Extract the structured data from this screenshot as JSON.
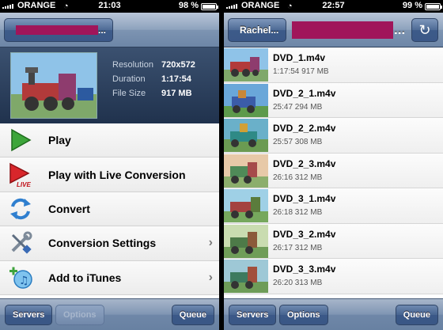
{
  "left_screen": {
    "status": {
      "carrier": "ORANGE",
      "time": "21:03",
      "battery": "98 %"
    },
    "nav": {
      "back_label_suffix": "..."
    },
    "video_info": {
      "resolution_label": "Resolution",
      "resolution_value": "720x572",
      "duration_label": "Duration",
      "duration_value": "1:17:54",
      "filesize_label": "File Size",
      "filesize_value": "917 MB"
    },
    "actions": [
      {
        "label": "Play",
        "icon": "play-icon"
      },
      {
        "label": "Play with Live Conversion",
        "icon": "play-live-icon",
        "badge": "LIVE"
      },
      {
        "label": "Convert",
        "icon": "convert-icon"
      },
      {
        "label": "Conversion Settings",
        "icon": "tools-icon",
        "chevron": true
      },
      {
        "label": "Add to iTunes",
        "icon": "add-itunes-icon",
        "chevron": true
      }
    ],
    "toolbar": {
      "servers": "Servers",
      "options": "Options",
      "queue": "Queue"
    }
  },
  "right_screen": {
    "status": {
      "carrier": "ORANGE",
      "time": "22:57",
      "battery": "99 %"
    },
    "nav": {
      "back_label": "Rachel...",
      "title_suffix": "..."
    },
    "files": [
      {
        "name": "DVD_1.m4v",
        "meta": "1:17:54  917 MB"
      },
      {
        "name": "DVD_2_1.m4v",
        "meta": "25:47  294 MB"
      },
      {
        "name": "DVD_2_2.m4v",
        "meta": "25:57  308 MB"
      },
      {
        "name": "DVD_2_3.m4v",
        "meta": "26:16  312 MB"
      },
      {
        "name": "DVD_3_1.m4v",
        "meta": "26:18  312 MB"
      },
      {
        "name": "DVD_3_2.m4v",
        "meta": "26:17  312 MB"
      },
      {
        "name": "DVD_3_3.m4v",
        "meta": "26:20  313 MB"
      }
    ],
    "toolbar": {
      "servers": "Servers",
      "options": "Options",
      "queue": "Queue"
    }
  },
  "colors": {
    "nav_blue": "#6d86a7",
    "redaction": "#a0155a"
  }
}
